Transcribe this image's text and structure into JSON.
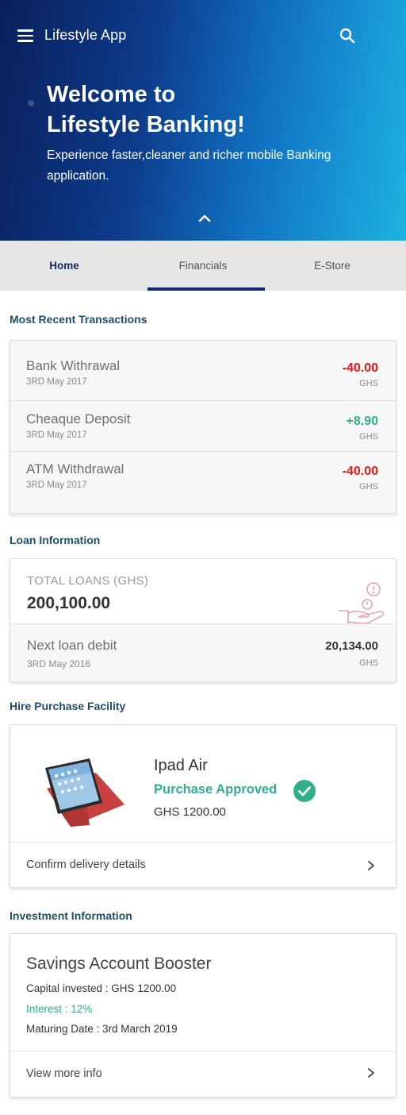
{
  "app": {
    "title": "Lifestyle App"
  },
  "hero": {
    "title_line1": "Welcome to",
    "title_line2": "Lifestyle Banking!",
    "subtitle_line1": "Experience faster,cleaner and richer mobile Banking",
    "subtitle_line2": "application."
  },
  "tabs": [
    {
      "label": "Home"
    },
    {
      "label": "Financials",
      "active": true
    },
    {
      "label": "E-Store"
    }
  ],
  "recent": {
    "title": "Most Recent Transactions",
    "items": [
      {
        "name": "Bank Withrawal",
        "date": "3RD May 2017",
        "amount": "-40.00",
        "currency": "GHS",
        "type": "debit"
      },
      {
        "name": "Cheaque Deposit",
        "date": "3RD May 2017",
        "amount": "+8.90",
        "currency": "GHS",
        "type": "credit"
      },
      {
        "name": "ATM Withdrawal",
        "date": "3RD May 2017",
        "amount": "-40.00",
        "currency": "GHS",
        "type": "debit"
      }
    ]
  },
  "loan": {
    "title": "Loan Information",
    "total_label": "TOTAL LOANS (GHS)",
    "total_value": "200,100.00",
    "next_label": "Next loan debit",
    "next_date": "3RD May 2016",
    "next_amount": "20,134.00",
    "next_currency": "GHS"
  },
  "hire": {
    "title": "Hire Purchase Facility",
    "product": "Ipad Air",
    "status": "Purchase Approved",
    "price": "GHS 1200.00",
    "link": "Confirm delivery details"
  },
  "investment": {
    "title": "Investment Information",
    "name": "Savings Account Booster",
    "capital": "Capital invested : GHS 1200.00",
    "interest": "Interest : 12%",
    "maturing": "Maturing Date : 3rd March 2019",
    "link": "View more info"
  },
  "colors": {
    "debit": "#e3191b",
    "credit": "#2fb08a",
    "section_title": "#1d4f6b",
    "tab_indicator": "#12297a"
  },
  "icons": [
    "menu-icon",
    "search-icon",
    "chevron-up-icon",
    "money-hand-icon",
    "check-circle-icon",
    "chevron-right-icon"
  ]
}
